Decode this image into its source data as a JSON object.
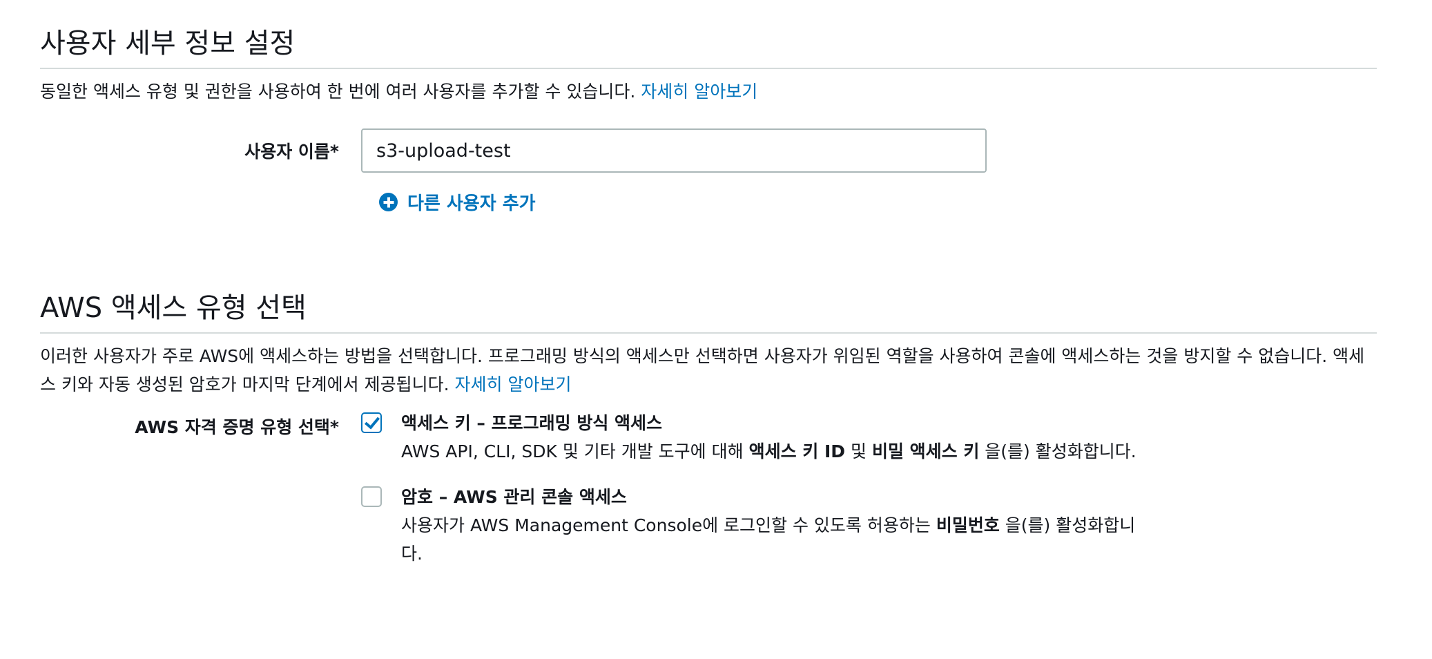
{
  "user_details": {
    "title": "사용자 세부 정보 설정",
    "description": "동일한 액세스 유형 및 권한을 사용하여 한 번에 여러 사용자를 추가할 수 있습니다.",
    "learn_more": "자세히 알아보기",
    "username_label": "사용자 이름*",
    "username_value": "s3-upload-test",
    "add_user_label": "다른 사용자 추가"
  },
  "access_type": {
    "title": "AWS 액세스 유형 선택",
    "description": "이러한 사용자가 주로 AWS에 액세스하는 방법을 선택합니다. 프로그래밍 방식의 액세스만 선택하면 사용자가 위임된 역할을 사용하여 콘솔에 액세스하는 것을 방지할 수 없습니다. 액세스 키와 자동 생성된 암호가 마지막 단계에서 제공됩니다.",
    "learn_more": "자세히 알아보기",
    "credential_label": "AWS 자격 증명 유형 선택*",
    "options": [
      {
        "checked": true,
        "title": "액세스 키 – 프로그래밍 방식 액세스",
        "desc_prefix": "AWS API, CLI, SDK 및 기타 개발 도구에 대해 ",
        "desc_bold1": "액세스 키 ID",
        "desc_mid": " 및 ",
        "desc_bold2": "비밀 액세스 키",
        "desc_suffix": " 을(를) 활성화합니다."
      },
      {
        "checked": false,
        "title": "암호 – AWS 관리 콘솔 액세스",
        "desc_prefix": "사용자가 AWS Management Console에 로그인할 수 있도록 허용하는 ",
        "desc_bold1": "비밀번호",
        "desc_suffix": " 을(를) 활성화합니다."
      }
    ]
  },
  "colors": {
    "link": "#0073bb",
    "text": "#16191f",
    "divider": "#d5dbdb",
    "input_border": "#aab7b8"
  }
}
